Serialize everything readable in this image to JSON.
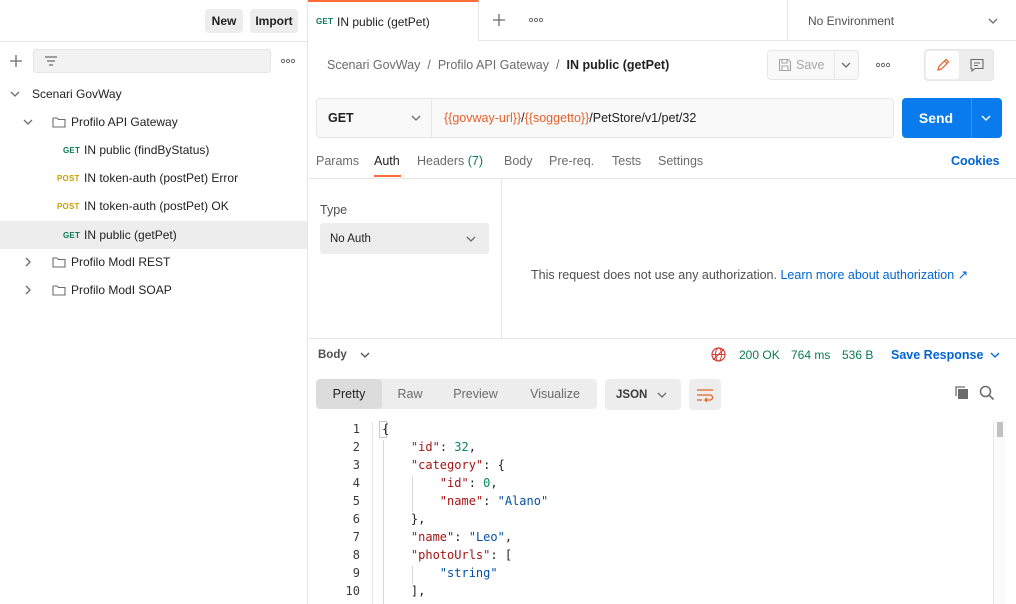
{
  "sidebar": {
    "new_label": "New",
    "import_label": "Import",
    "collection_name": "Scenari GovWay",
    "tree": [
      {
        "kind": "folder",
        "label": "Profilo API Gateway",
        "expanded": true
      },
      {
        "kind": "request",
        "method": "GET",
        "label": "IN public (findByStatus)"
      },
      {
        "kind": "request",
        "method": "POST",
        "label": "IN token-auth (postPet) Error"
      },
      {
        "kind": "request",
        "method": "POST",
        "label": "IN token-auth (postPet) OK"
      },
      {
        "kind": "request",
        "method": "GET",
        "label": "IN public (getPet)",
        "selected": true
      },
      {
        "kind": "folder",
        "label": "Profilo ModI REST",
        "expanded": false
      },
      {
        "kind": "folder",
        "label": "Profilo ModI SOAP",
        "expanded": false
      }
    ]
  },
  "tab": {
    "method": "GET",
    "title": "IN public (getPet)"
  },
  "environment": {
    "label": "No Environment"
  },
  "breadcrumb": {
    "items": [
      "Scenari GovWay",
      "Profilo API Gateway",
      "IN public (getPet)"
    ],
    "separator": "/"
  },
  "toolbar": {
    "save_label": "Save"
  },
  "request": {
    "method": "GET",
    "url_parts": [
      {
        "text": "{{govway-url}}",
        "var": true
      },
      {
        "text": "/",
        "var": false
      },
      {
        "text": "{{soggetto}}",
        "var": true
      },
      {
        "text": "/PetStore/v1/pet/32",
        "var": false
      }
    ],
    "send_label": "Send"
  },
  "request_tabs": [
    {
      "label": "Params"
    },
    {
      "label": "Auth",
      "active": true
    },
    {
      "label": "Headers",
      "count": "(7)"
    },
    {
      "label": "Body"
    },
    {
      "label": "Pre-req."
    },
    {
      "label": "Tests"
    },
    {
      "label": "Settings"
    }
  ],
  "cookies_label": "Cookies",
  "auth": {
    "type_label": "Type",
    "type_value": "No Auth",
    "message": "This request does not use any authorization.",
    "learn_more": "Learn more about authorization ↗"
  },
  "response": {
    "section_label": "Body",
    "status": "200 OK",
    "time": "764 ms",
    "size": "536 B",
    "save_response_label": "Save Response",
    "view_tabs": [
      {
        "label": "Pretty",
        "active": true
      },
      {
        "label": "Raw"
      },
      {
        "label": "Preview"
      },
      {
        "label": "Visualize"
      }
    ],
    "format": "JSON",
    "line_numbers": [
      "1",
      "2",
      "3",
      "4",
      "5",
      "6",
      "7",
      "8",
      "9",
      "10"
    ]
  },
  "colors": {
    "accent": "#ff6c37",
    "send_blue": "#097bed",
    "link_blue": "#0265d2",
    "status_green": "#0b7a52",
    "var_orange": "#e5612a"
  }
}
